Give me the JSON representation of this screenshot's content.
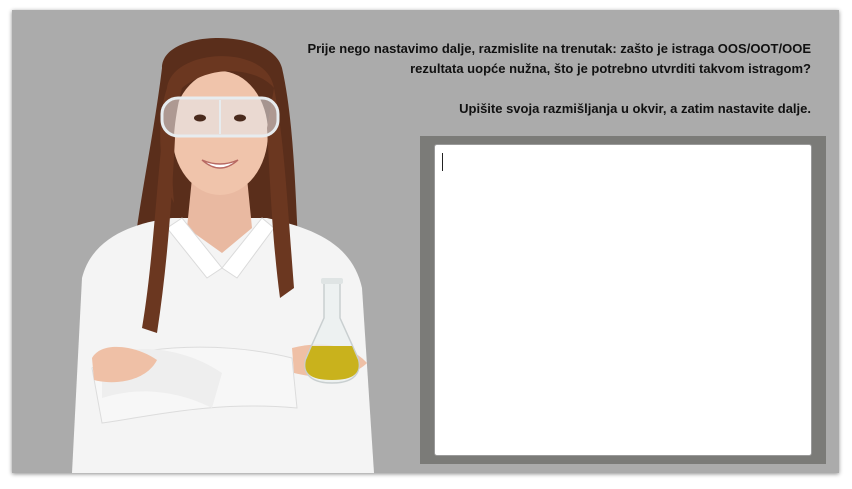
{
  "slide": {
    "prompt_line1": "Prije nego nastavimo dalje, razmislite na trenutak: zašto je istraga OOS/OOT/OOE",
    "prompt_line2": "rezultata uopće nužna, što je potrebno utvrditi takvom istragom?",
    "instruction": "Upišite svoja razmišljanja u okvir, a zatim nastavite dalje.",
    "answer_value": "",
    "illustration_icon": "scientist-with-flask-icon"
  },
  "colors": {
    "slide_background": "#ababab",
    "frame": "#7b7b78",
    "answer_box": "#ffffff",
    "liquid": "#c9b21c"
  }
}
